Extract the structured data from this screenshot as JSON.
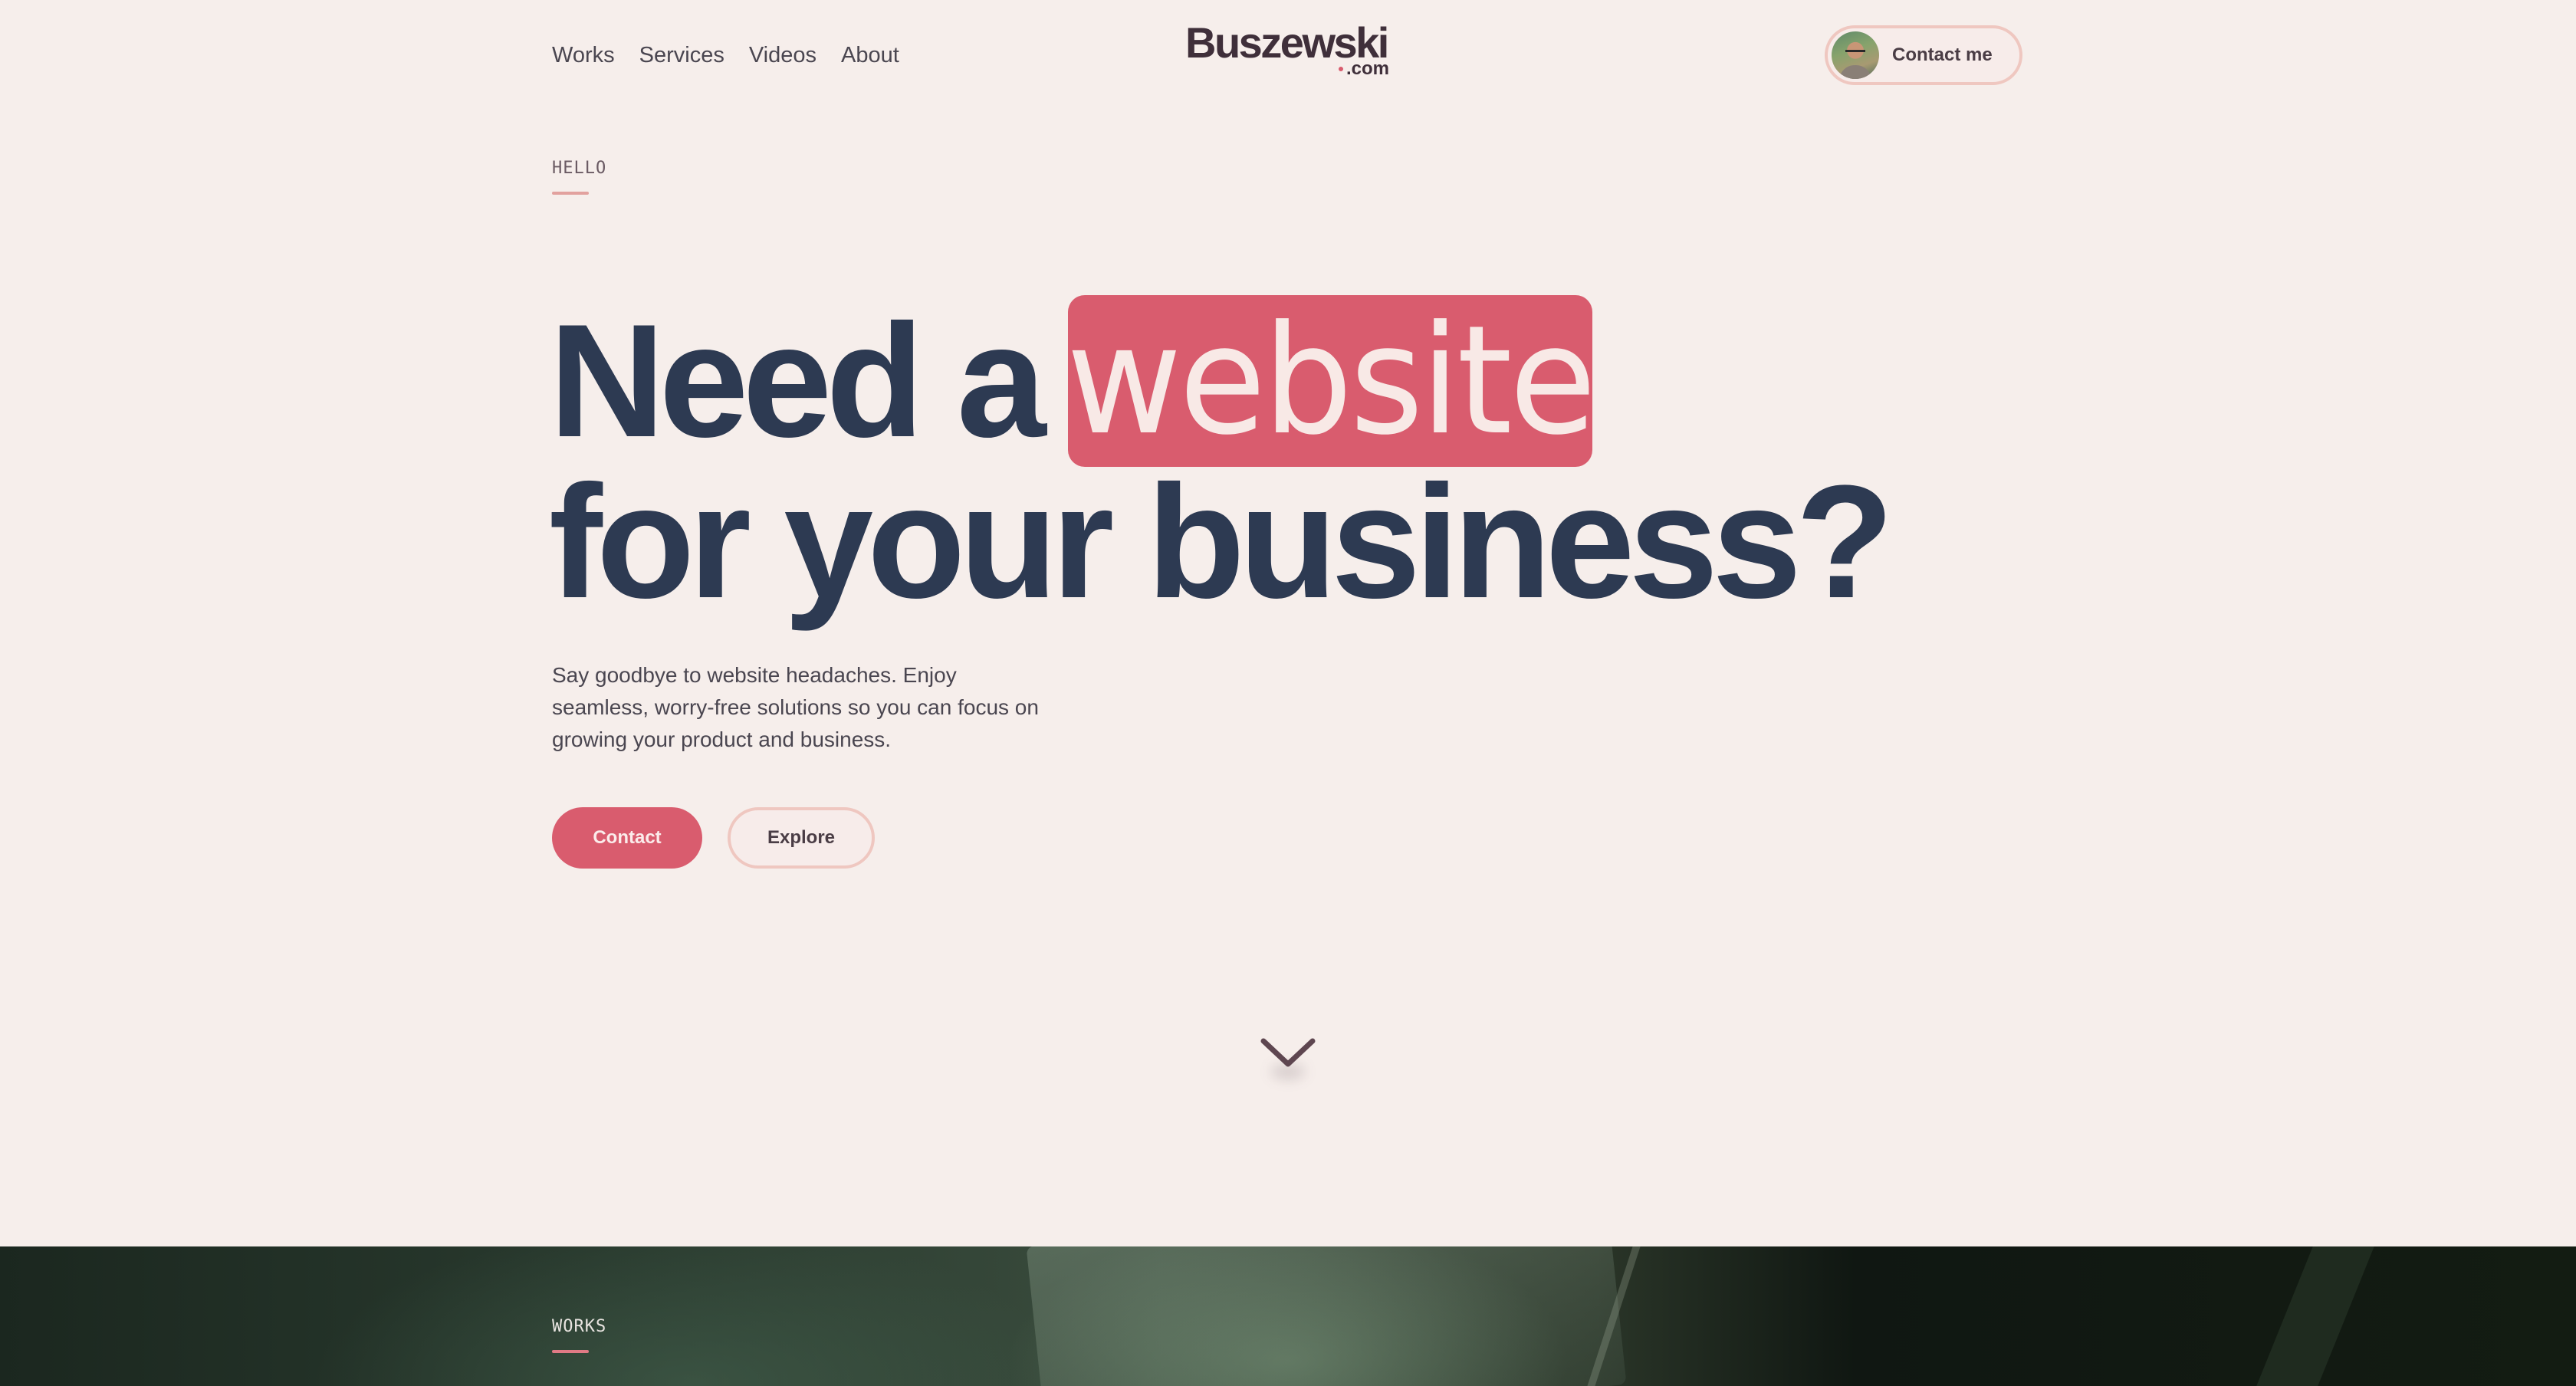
{
  "nav": {
    "items": [
      {
        "label": "Works"
      },
      {
        "label": "Services"
      },
      {
        "label": "Videos"
      },
      {
        "label": "About"
      }
    ]
  },
  "logo": {
    "main": "Buszewski",
    "sub": ".com"
  },
  "header": {
    "contact_label": "Contact me",
    "avatar_icon": "profile-photo"
  },
  "hero": {
    "eyebrow": "HELLO",
    "headline_part1": "Need a",
    "headline_highlight": "website",
    "headline_line2": "for your business?",
    "subtext": "Say goodbye to website headaches. Enjoy seamless, worry-free solutions so you can focus on growing your product and business.",
    "primary_button": "Contact",
    "secondary_button": "Explore",
    "scroll_icon": "chevron-down-icon"
  },
  "works": {
    "eyebrow": "WORKS"
  },
  "colors": {
    "background": "#f6eeeb",
    "accent": "#d95c6e",
    "heading": "#2d3a52",
    "pill_border": "#efc7c0"
  }
}
